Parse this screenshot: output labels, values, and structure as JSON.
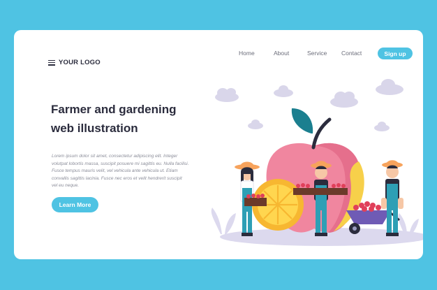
{
  "header": {
    "logo_text": "YOUR LOGO",
    "nav": [
      "Home",
      "About",
      "Service",
      "Contact"
    ],
    "signup_label": "Sign up"
  },
  "hero": {
    "title_line1": "Farmer and gardening",
    "title_line2": "web illustration",
    "body_lines": [
      "Lorem ipsum dolor sit amet, consectetur adipiscing elit. Integer",
      "volutpat lobortis massa, suscipit posuere mi sagittis eu. Nulla facilisi.",
      "Fusce tempus mauris velit, vel vehicula ante vehicula ut. Etiam",
      "convallis sagittis lacinia. Fusce nec eros et velit hendrerit suscipit",
      "vel eu neque."
    ],
    "cta_label": "Learn More"
  },
  "colors": {
    "background": "#4fc3e3",
    "card": "#ffffff",
    "accent": "#4fc3e3",
    "heading": "#2b2c3d"
  }
}
